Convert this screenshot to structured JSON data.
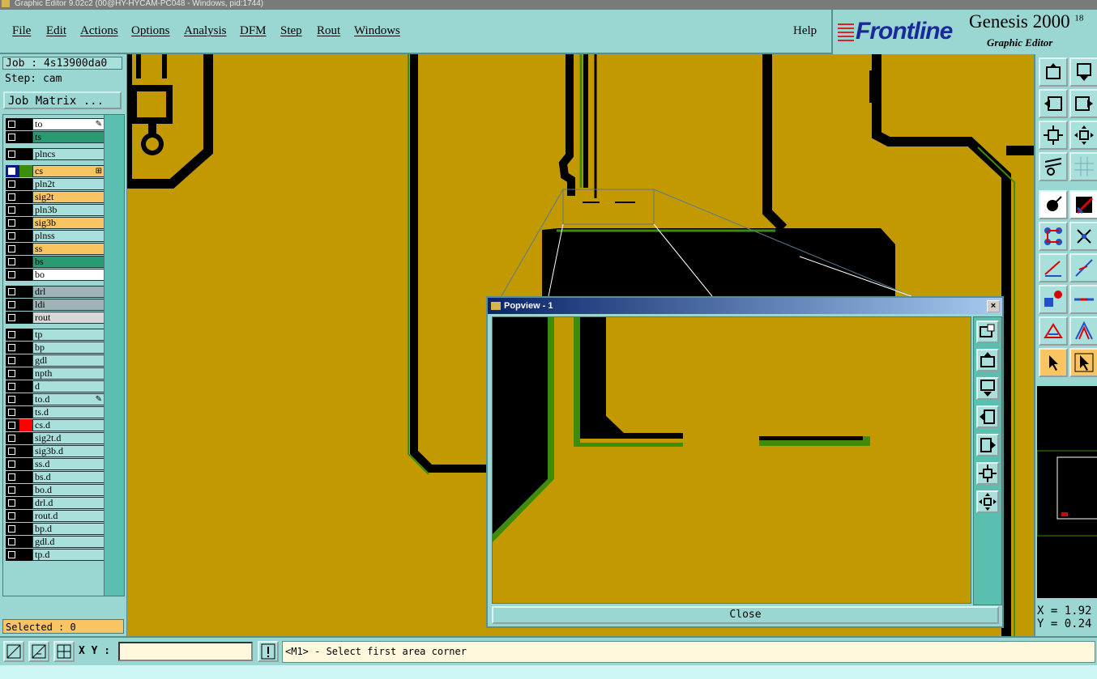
{
  "window": {
    "title": "Graphic Editor 9.02c2 (00@HY-HYCAM-PC048 - Windows, pid:1744)"
  },
  "menu": [
    "File",
    "Edit",
    "Actions",
    "Options",
    "Analysis",
    "DFM",
    "Step",
    "Rout",
    "Windows"
  ],
  "help_label": "Help",
  "brand": {
    "logo": "Frontline",
    "product": "Genesis 2000",
    "product_sup": "18",
    "subtitle": "Graphic Editor"
  },
  "job": {
    "label": "Job : 4s13900da0",
    "step": "Step: cam",
    "matrix_button": "Job Matrix ..."
  },
  "layers": [
    {
      "name": "to",
      "color": "#ffffff",
      "mark": "edit"
    },
    {
      "name": "ts",
      "color": "#2a9a72"
    },
    {
      "name": "plncs",
      "color": "#a9e0dc"
    },
    {
      "name": "cs",
      "color": "#f9c462",
      "mark": "work",
      "affected": true
    },
    {
      "name": "pln2t",
      "color": "#a9e0dc"
    },
    {
      "name": "sig2t",
      "color": "#f9c462"
    },
    {
      "name": "pln3b",
      "color": "#a9e0dc"
    },
    {
      "name": "sig3b",
      "color": "#f9c462"
    },
    {
      "name": "plnss",
      "color": "#a9e0dc"
    },
    {
      "name": "ss",
      "color": "#f9c462"
    },
    {
      "name": "bs",
      "color": "#2a9a72"
    },
    {
      "name": "bo",
      "color": "#ffffff"
    },
    {
      "name": "drl",
      "color": "#a0b4b8"
    },
    {
      "name": "ldi",
      "color": "#a0b4b8"
    },
    {
      "name": "rout",
      "color": "#d8d8d8"
    },
    {
      "name": "tp",
      "color": "#a9e0dc"
    },
    {
      "name": "bp",
      "color": "#a9e0dc"
    },
    {
      "name": "gdl",
      "color": "#a9e0dc"
    },
    {
      "name": "npth",
      "color": "#a9e0dc"
    },
    {
      "name": "d",
      "color": "#a9e0dc"
    },
    {
      "name": "to.d",
      "color": "#a9e0dc",
      "mark": "edit"
    },
    {
      "name": "ts.d",
      "color": "#a9e0dc"
    },
    {
      "name": "cs.d",
      "color": "#a9e0dc",
      "swatch": "#ff0000"
    },
    {
      "name": "sig2t.d",
      "color": "#a9e0dc"
    },
    {
      "name": "sig3b.d",
      "color": "#a9e0dc"
    },
    {
      "name": "ss.d",
      "color": "#a9e0dc"
    },
    {
      "name": "bs.d",
      "color": "#a9e0dc"
    },
    {
      "name": "bo.d",
      "color": "#a9e0dc"
    },
    {
      "name": "drl.d",
      "color": "#a9e0dc"
    },
    {
      "name": "rout.d",
      "color": "#a9e0dc"
    },
    {
      "name": "bp.d",
      "color": "#a9e0dc"
    },
    {
      "name": "gdl.d",
      "color": "#a9e0dc"
    },
    {
      "name": "tp.d",
      "color": "#a9e0dc"
    }
  ],
  "selected": "Selected : 0",
  "coords": {
    "x": "X = 1.92",
    "y": "Y = 0.24"
  },
  "xy_label": "X Y :",
  "xy_value": "",
  "status": "<M1> - Select first area corner",
  "popview": {
    "title": "Popview - 1",
    "close_label": "Close"
  },
  "colors": {
    "board": "#c29a00",
    "copper": "#000000",
    "highlight": "#3d8c0a",
    "panel": "#9ad6d2",
    "accent": "#f9c462"
  }
}
